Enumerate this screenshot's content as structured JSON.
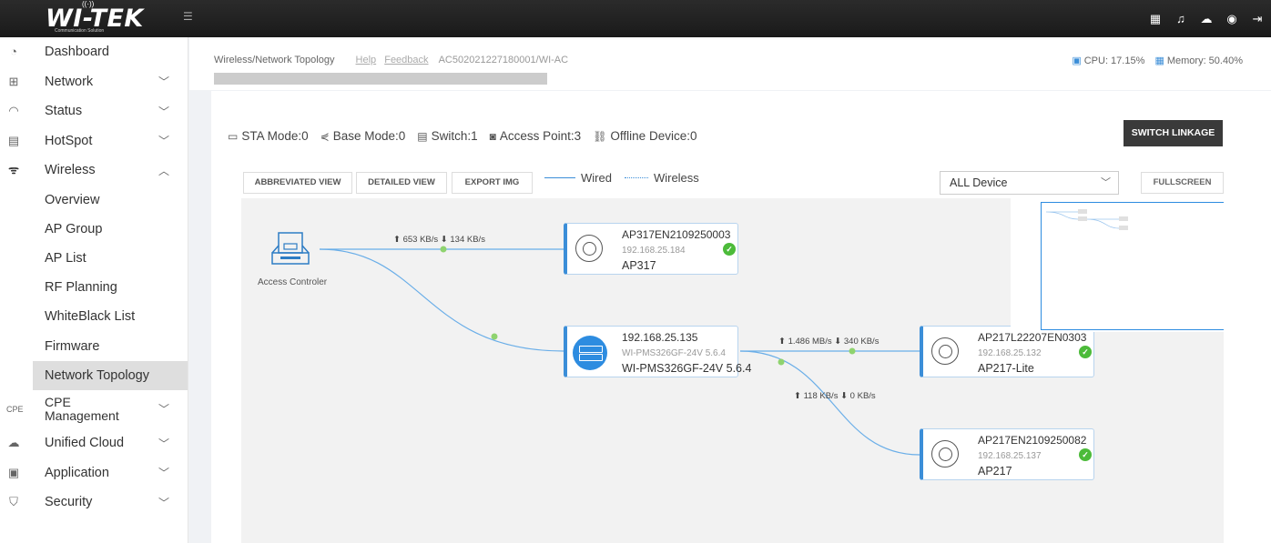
{
  "topbar": {
    "logo_text": "WI-TEK",
    "logo_sub": "Communication Solution",
    "menu_icon": "menu-icon",
    "icons": [
      "qrcode-icon",
      "bell-icon",
      "cloud-icon",
      "globe-icon",
      "logout-icon"
    ]
  },
  "sidebar": {
    "items": [
      {
        "label": "Dashboard",
        "icon": "dashboard-icon",
        "chevron": ""
      },
      {
        "label": "Network",
        "icon": "network-icon",
        "chevron": "﹀"
      },
      {
        "label": "Status",
        "icon": "status-icon",
        "chevron": "﹀"
      },
      {
        "label": "HotSpot",
        "icon": "hotspot-icon",
        "chevron": "﹀"
      },
      {
        "label": "Wireless",
        "icon": "wifi-icon",
        "chevron": "︿"
      }
    ],
    "wireless_sub": [
      "Overview",
      "AP Group",
      "AP List",
      "RF Planning",
      "WhiteBlack List",
      "Firmware",
      "Network Topology"
    ],
    "active_sub": "Network Topology",
    "items_after": [
      {
        "label": "CPE Management",
        "icon": "cpe-icon",
        "chevron": "﹀"
      },
      {
        "label": "Unified Cloud",
        "icon": "cloud-icon",
        "chevron": "﹀"
      },
      {
        "label": "Application",
        "icon": "application-icon",
        "chevron": "﹀"
      },
      {
        "label": "Security",
        "icon": "security-icon",
        "chevron": "﹀"
      }
    ]
  },
  "header": {
    "breadcrumb": "Wireless/Network Topology",
    "help": "Help",
    "feedback": "Feedback",
    "device_path": "AC502021227180001/WI-AC",
    "cpu": "CPU: 17.15%",
    "memory": "Memory: 50.40%"
  },
  "counts": {
    "sta": "STA Mode:0",
    "base": "Base Mode:0",
    "switch": "Switch:1",
    "ap": "Access Point:3",
    "offline": "Offline Device:0"
  },
  "toolbar": {
    "switch_linkage": "SWITCH LINKAGE",
    "abbreviated": "ABBREVIATED VIEW",
    "detailed": "DETAILED VIEW",
    "export": "EXPORT IMG",
    "wired": "Wired",
    "wireless": "Wireless",
    "device_filter": "ALL Device",
    "fullscreen": "FULLSCREEN"
  },
  "topology": {
    "controller_label": "Access Controler",
    "ap1": {
      "name": "AP317EN2109250003",
      "ip": "192.168.25.184",
      "model": "AP317"
    },
    "switch": {
      "name": "192.168.25.135",
      "ip": "WI-PMS326GF-24V 5.6.4",
      "model": "WI-PMS326GF-24V 5.6.4"
    },
    "ap2": {
      "name": "AP217L22207EN0303",
      "ip": "192.168.25.132",
      "model": "AP217-Lite"
    },
    "ap3": {
      "name": "AP217EN2109250082",
      "ip": "192.168.25.137",
      "model": "AP217"
    },
    "link1": "⬆ 653 KB/s ⬇ 134 KB/s",
    "link2": "⬆ 1.486 MB/s ⬇ 340 KB/s",
    "link3": "⬆ 118 KB/s ⬇ 0 KB/s"
  },
  "colors": {
    "accent": "#3b8ed8",
    "online": "#4cbb3a",
    "topbar": "#222222"
  }
}
